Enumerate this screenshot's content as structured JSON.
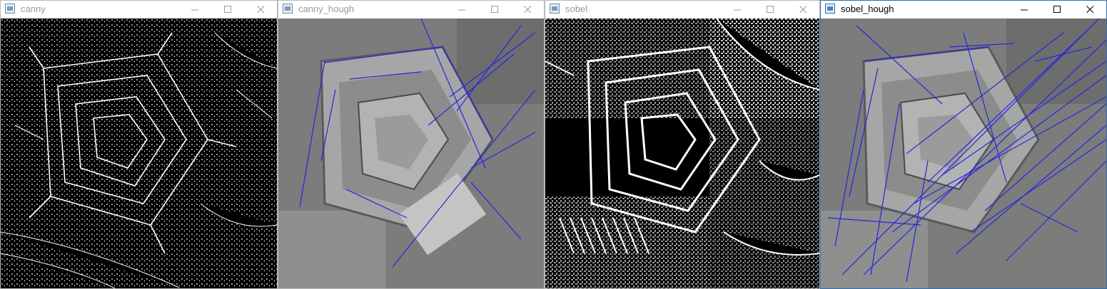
{
  "windows": [
    {
      "title": "canny",
      "active": false,
      "content": "edges"
    },
    {
      "title": "canny_hough",
      "active": false,
      "content": "photo-lines"
    },
    {
      "title": "sobel",
      "active": false,
      "content": "sobel"
    },
    {
      "title": "sobel_hough",
      "active": true,
      "content": "photo-lines-dense"
    }
  ],
  "icons": {
    "app": "app-image-icon",
    "minimize": "minimize-icon",
    "maximize": "maximize-icon",
    "close": "close-icon"
  },
  "colors": {
    "hough_line": "#2626e0",
    "active_border": "#2a6fb5",
    "inactive_title": "#9a9a9a"
  }
}
